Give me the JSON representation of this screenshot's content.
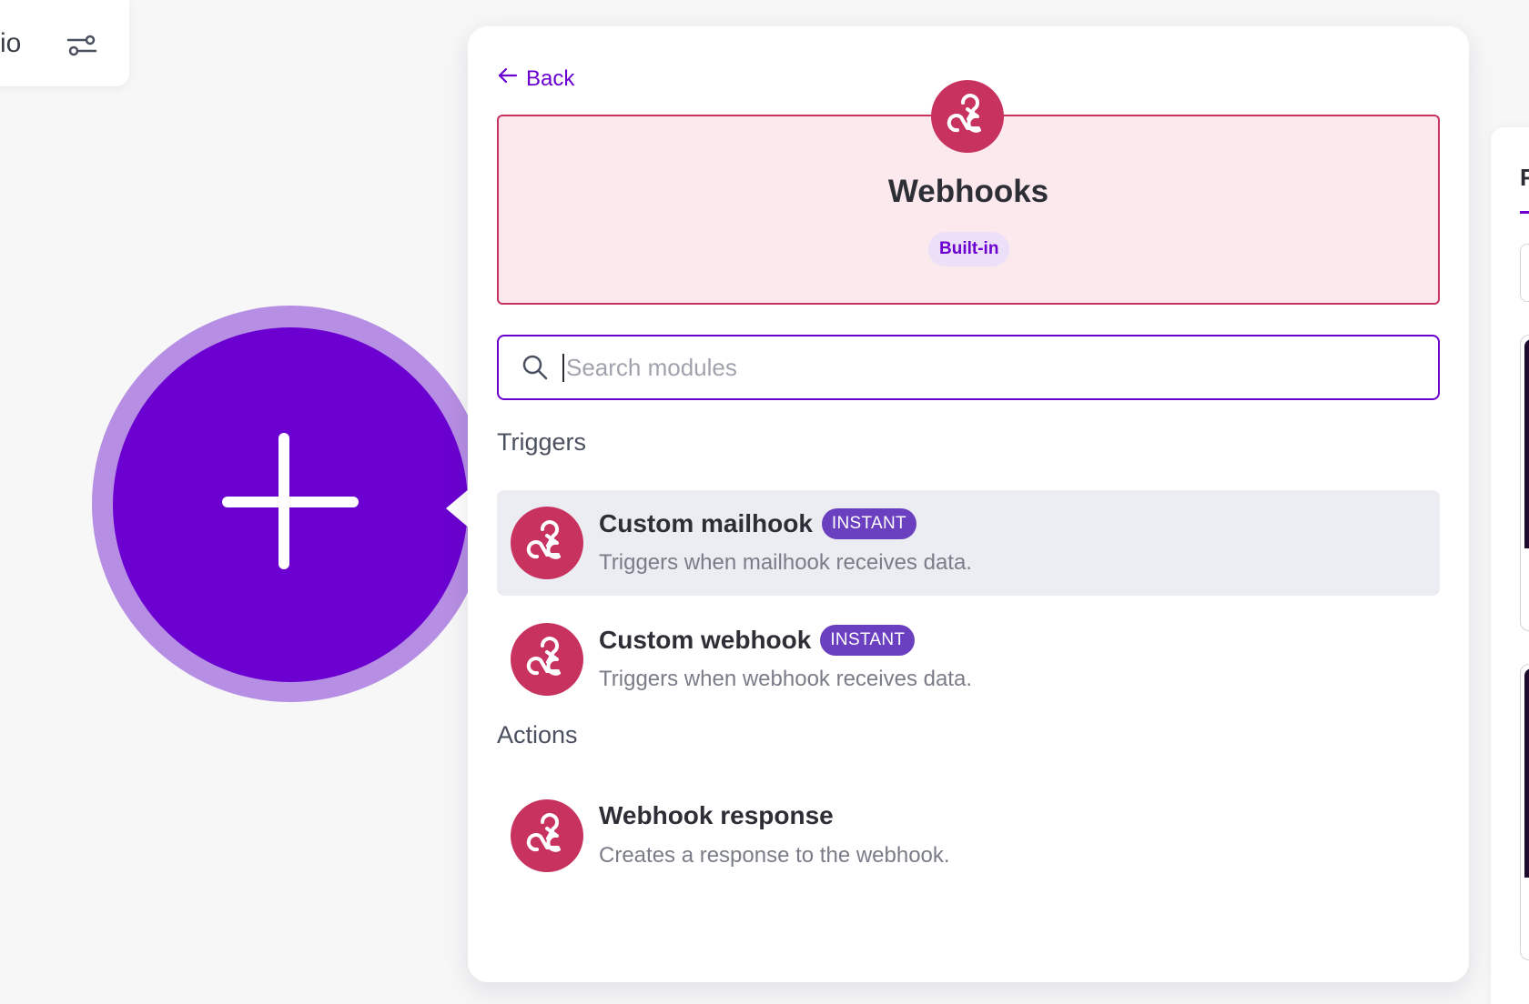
{
  "toolbar": {
    "partial_text": "io",
    "settings_icon": "sliders-icon"
  },
  "canvas": {
    "add_icon": "plus-icon"
  },
  "panel": {
    "back_label": "Back",
    "back_icon": "arrow-left-icon",
    "app": {
      "icon": "webhook-icon",
      "title": "Webhooks",
      "badge": "Built-in",
      "brand_color": "#c8325f"
    },
    "search": {
      "placeholder": "Search modules",
      "value": ""
    },
    "sections": [
      {
        "heading": "Triggers",
        "modules": [
          {
            "title": "Custom mailhook",
            "badge": "INSTANT",
            "description": "Triggers when mailhook receives data."
          },
          {
            "title": "Custom webhook",
            "badge": "INSTANT",
            "description": "Triggers when webhook receives data."
          }
        ]
      },
      {
        "heading": "Actions",
        "modules": [
          {
            "title": "Webhook response",
            "description": "Creates a response to the webhook."
          }
        ]
      }
    ]
  },
  "right_panel": {
    "partial_tab": "F"
  },
  "colors": {
    "accent": "#6b00d1",
    "accent_ring": "#b68ee3",
    "instant_badge": "#6a3fc0",
    "header_bg": "#fbe9ee"
  }
}
